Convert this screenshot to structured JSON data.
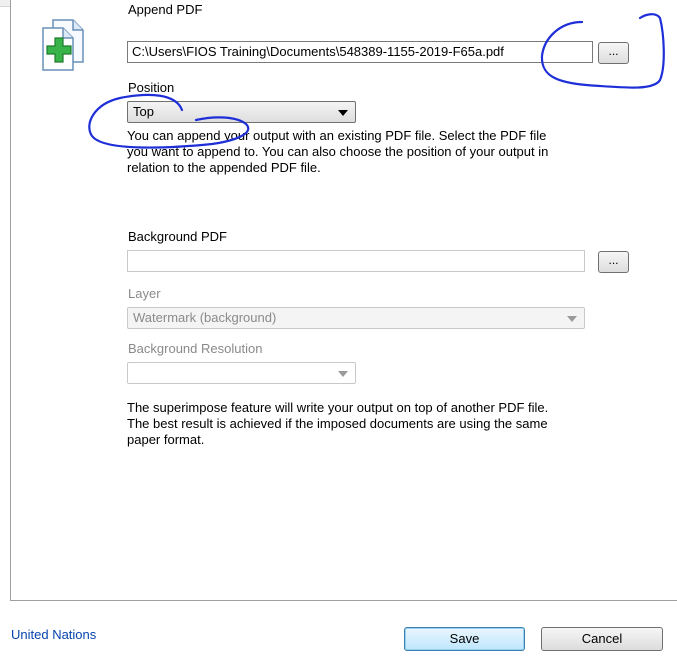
{
  "append": {
    "label": "Append PDF",
    "file_value": "C:\\Users\\FIOS Training\\Documents\\548389-1155-2019-F65a.pdf",
    "browse_label": "...",
    "position_label": "Position",
    "position_value": "Top",
    "description": "You can append your output with an existing PDF file. Select the PDF file\nyou want to append to. You can also choose the position of your output in\nrelation to the appended PDF file."
  },
  "background": {
    "label": "Background PDF",
    "file_value": "",
    "browse_label": "...",
    "layer_label": "Layer",
    "layer_value": "Watermark (background)",
    "resolution_label": "Background Resolution",
    "resolution_value": "",
    "description": "The superimpose feature will write your output on top of another PDF file.\nThe best result is achieved if the imposed documents are using the same\npaper format."
  },
  "footer": {
    "link": "United Nations",
    "save_label": "Save",
    "cancel_label": "Cancel"
  },
  "icons": {
    "append_icon": "document-add-icon"
  },
  "colors": {
    "link": "#0645ad",
    "annotation_ink": "#1f2fd8",
    "plus_green": "#38b44a"
  }
}
